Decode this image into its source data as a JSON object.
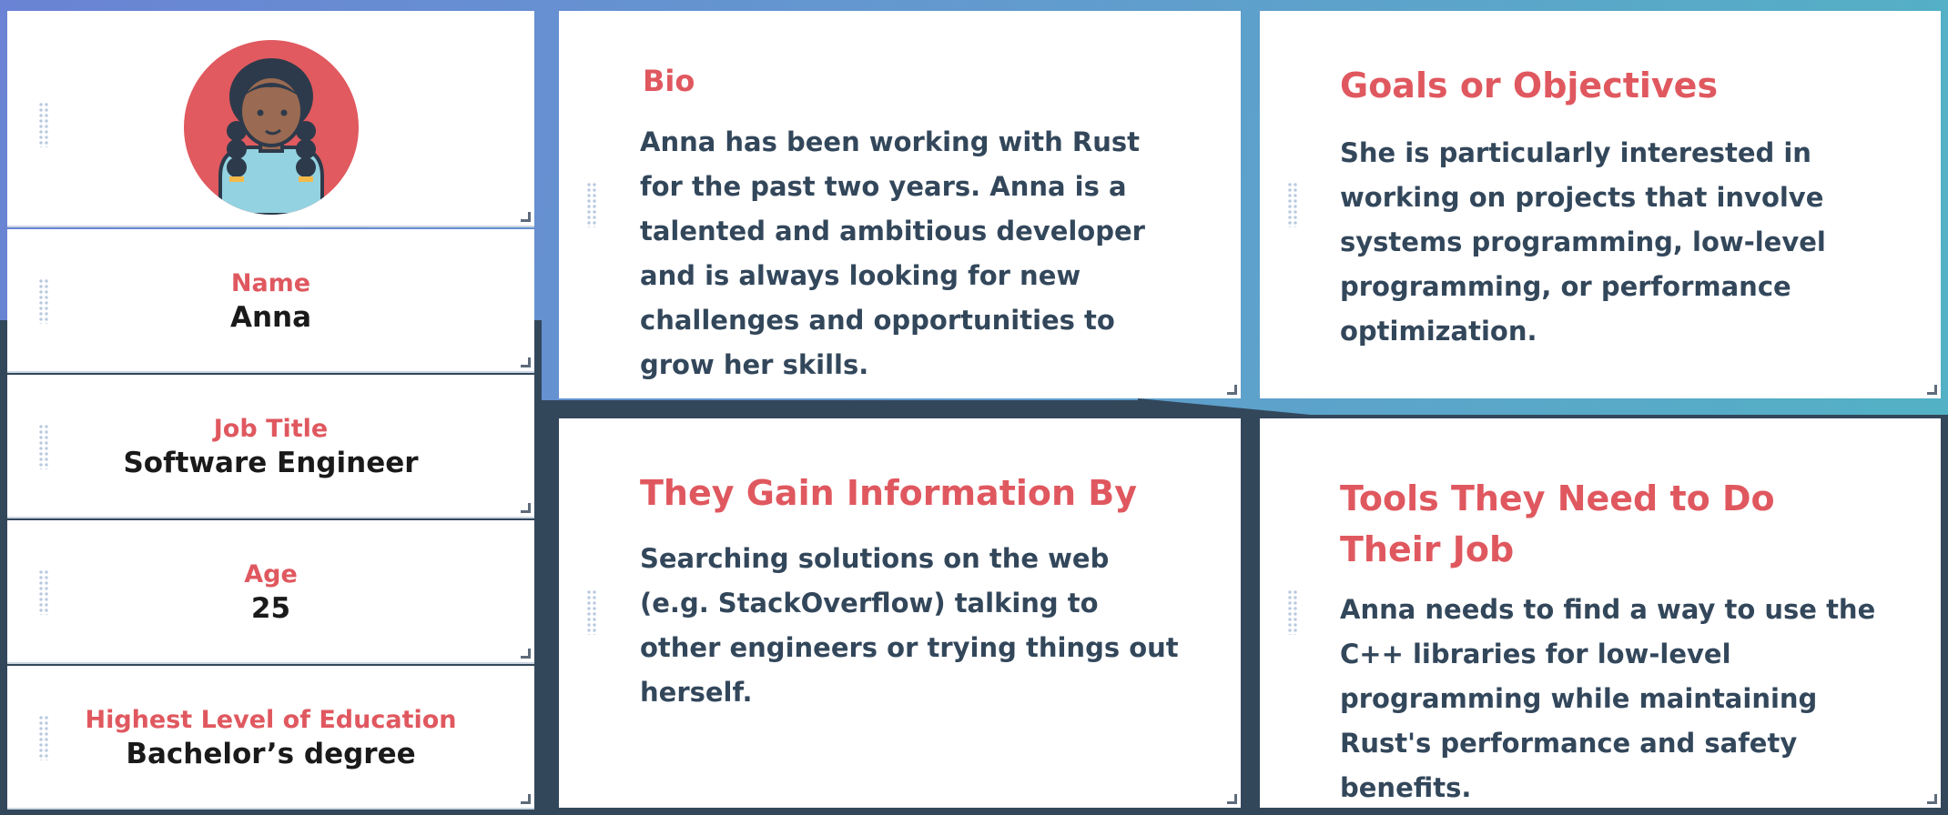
{
  "profile": {
    "avatar_alt": "Anna avatar",
    "fields": [
      {
        "label": "Name",
        "value": "Anna"
      },
      {
        "label": "Job Title",
        "value": "Software Engineer"
      },
      {
        "label": "Age",
        "value": "25"
      },
      {
        "label": "Highest Level of Education",
        "value": "Bachelor’s degree"
      }
    ]
  },
  "bio": {
    "title": "Bio",
    "text": "Anna has been working with Rust for the past two years. Anna is a talented and ambitious developer and is always looking for new challenges and opportunities to grow her skills."
  },
  "goals": {
    "title": "Goals or Objectives",
    "text": "She is particularly interested in working on projects that involve systems programming, low-level programming, or performance optimization."
  },
  "information": {
    "title": "They Gain Information By",
    "text": "Searching solutions on the web (e.g. StackOverflow) talking to other engineers or trying things out herself."
  },
  "tools": {
    "title": "Tools They Need to Do Their Job",
    "text": "Anna needs to find a way to use the C++ libraries for low-level programming while maintaining Rust's performance and safety benefits."
  },
  "colors": {
    "accent": "#e0585f",
    "text_dark": "#33475b",
    "background": "#33475b"
  }
}
